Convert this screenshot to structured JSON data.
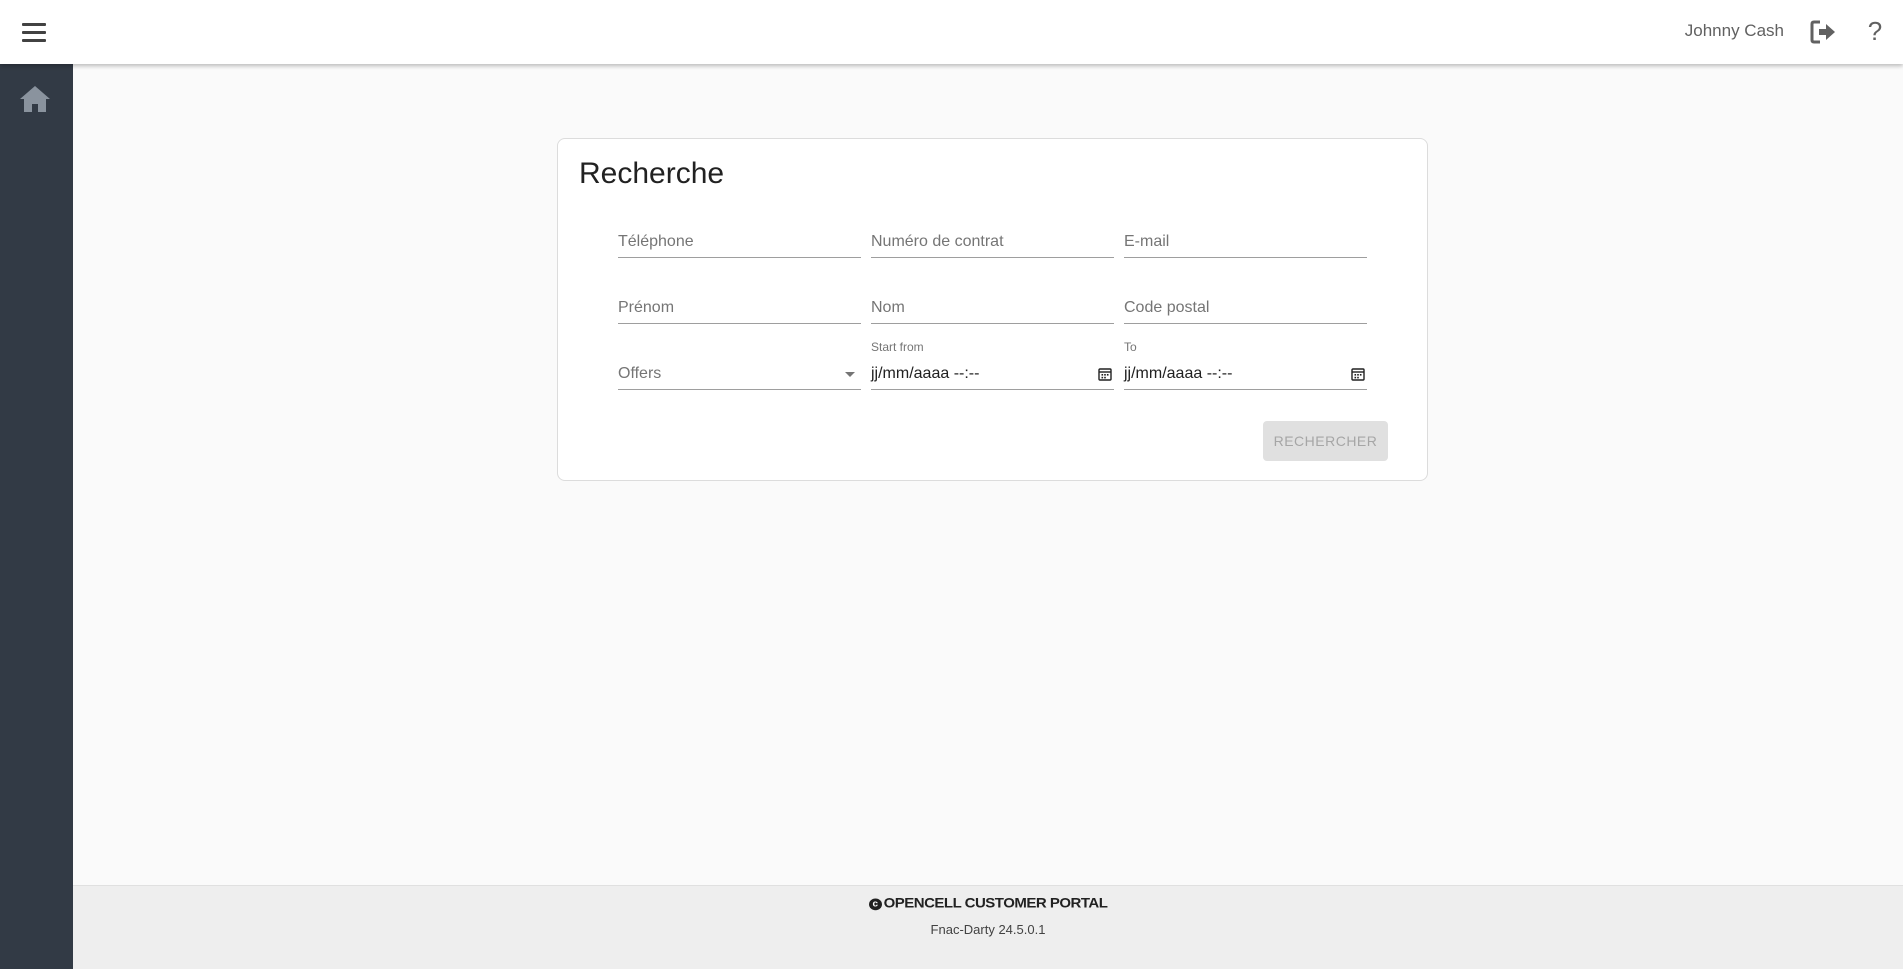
{
  "header": {
    "user_name": "Johnny Cash",
    "help_label": "?"
  },
  "search": {
    "title": "Recherche",
    "phone_placeholder": "Téléphone",
    "contract_placeholder": "Numéro de contrat",
    "email_placeholder": "E-mail",
    "firstname_placeholder": "Prénom",
    "lastname_placeholder": "Nom",
    "postal_placeholder": "Code postal",
    "offers_placeholder": "Offers",
    "start_label": "Start from",
    "start_value": "jj/mm/aaaa --:--",
    "to_label": "To",
    "to_value": "jj/mm/aaaa --:--",
    "submit_label": "RECHERCHER"
  },
  "footer": {
    "copyright_symbol": "c",
    "brand": "OPENCELL CUSTOMER PORTAL",
    "version": "Fnac-Darty 24.5.0.1"
  },
  "icons": {
    "menu": "menu-icon",
    "logout": "logout-icon",
    "help": "help-icon",
    "home": "home-icon",
    "calendar": "calendar-icon",
    "dropdown": "chevron-down-icon"
  },
  "colors": {
    "sidebar": "#323a45",
    "background": "#fafafa",
    "button_disabled": "#e0e0e0"
  }
}
